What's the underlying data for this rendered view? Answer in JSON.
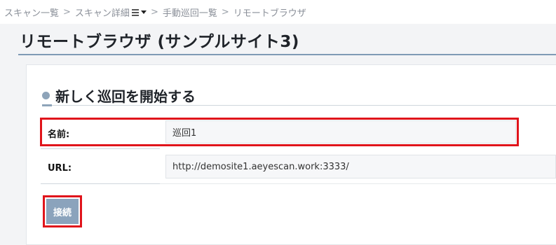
{
  "breadcrumb": {
    "items": [
      "スキャン一覧",
      "スキャン詳細",
      "手動巡回一覧",
      "リモートブラウザ"
    ],
    "separator": ">"
  },
  "page": {
    "title": "リモートブラウザ (サンプルサイト3)"
  },
  "section": {
    "title": "新しく巡回を開始する"
  },
  "form": {
    "name_label": "名前:",
    "name_value": "巡回1",
    "url_label": "URL:",
    "url_value": "http://demosite1.aeyescan.work:3333/"
  },
  "actions": {
    "connect_label": "接続"
  },
  "colors": {
    "accent": "#8ba3bc",
    "highlight": "#e0141b"
  }
}
